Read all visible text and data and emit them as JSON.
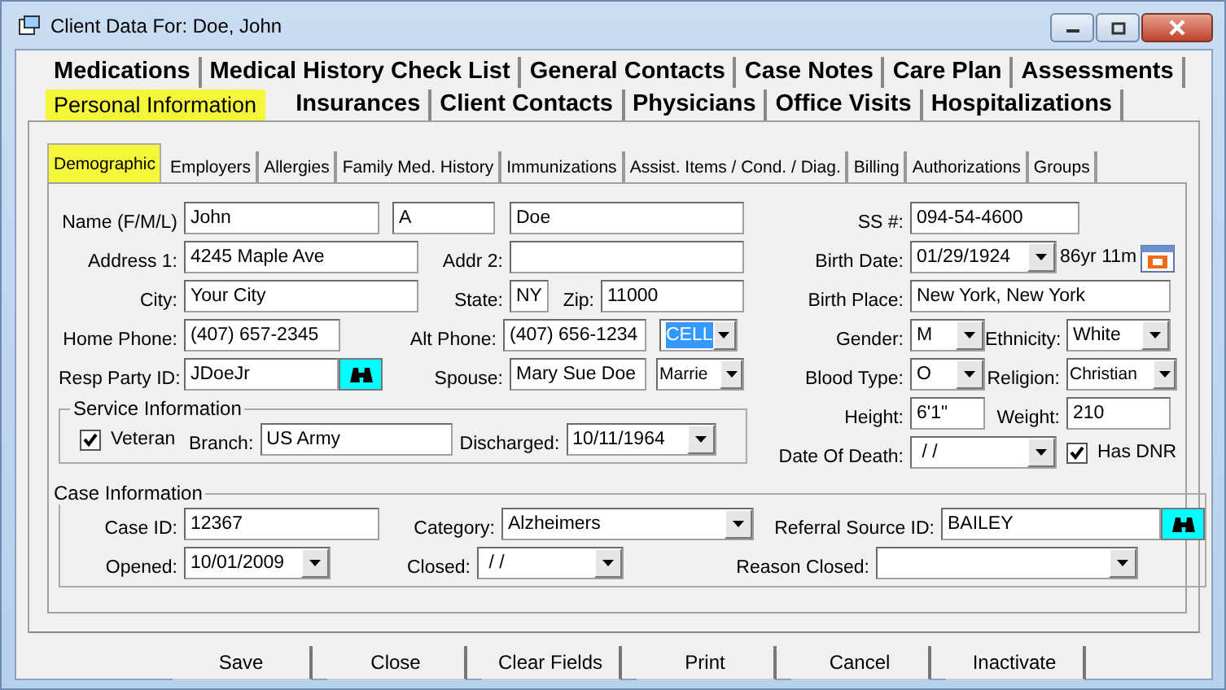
{
  "window": {
    "title": "Client Data For: Doe, John"
  },
  "main_tab_rows": [
    {
      "tabs": [
        {
          "label": "Medications",
          "selected": false
        },
        {
          "label": "Medical History Check List",
          "selected": false
        },
        {
          "label": "General Contacts",
          "selected": false
        },
        {
          "label": "Case Notes",
          "selected": false
        },
        {
          "label": "Care Plan",
          "selected": false
        },
        {
          "label": "Assessments",
          "selected": false
        }
      ]
    },
    {
      "tabs": [
        {
          "label": "Personal Information",
          "selected": true
        },
        {
          "label": "Insurances",
          "selected": false
        },
        {
          "label": "Client Contacts",
          "selected": false
        },
        {
          "label": "Physicians",
          "selected": false
        },
        {
          "label": "Office Visits",
          "selected": false
        },
        {
          "label": "Hospitalizations",
          "selected": false
        }
      ]
    }
  ],
  "sub_tabs": [
    {
      "label": "Demographic",
      "selected": true
    },
    {
      "label": "Employers",
      "selected": false
    },
    {
      "label": "Allergies",
      "selected": false
    },
    {
      "label": "Family Med. History",
      "selected": false
    },
    {
      "label": "Immunizations",
      "selected": false
    },
    {
      "label": "Assist. Items / Cond. / Diag.",
      "selected": false
    },
    {
      "label": "Billing",
      "selected": false
    },
    {
      "label": "Authorizations",
      "selected": false
    },
    {
      "label": "Groups",
      "selected": false
    }
  ],
  "demographic": {
    "name": {
      "label": "Name (F/M/L)",
      "first": "John",
      "middle": "A",
      "last": "Doe"
    },
    "address1": {
      "label": "Address 1:",
      "value": "4245 Maple Ave"
    },
    "address2": {
      "label": "Addr 2:"
    },
    "city": {
      "label": "City:",
      "value": "Your City"
    },
    "state": {
      "label": "State:",
      "value": "NY"
    },
    "zip": {
      "label": "Zip:",
      "value": "11000"
    },
    "home_phone": {
      "label": "Home Phone:",
      "value": "(407) 657-2345"
    },
    "alt_phone": {
      "label": "Alt Phone:",
      "value": "(407) 656-1234",
      "type": "CELL",
      "type_highlighted": true
    },
    "resp_party_id": {
      "label": "Resp Party ID:",
      "value": "JDoeJr"
    },
    "spouse": {
      "label": "Spouse:",
      "value": "Mary Sue Doe",
      "marital_status": "Marrie"
    },
    "ss": {
      "label": "SS #:",
      "value": "094-54-4600"
    },
    "birth_date": {
      "label": "Birth Date:",
      "value": "01/29/1924",
      "age": "86yr 11m"
    },
    "birth_place": {
      "label": "Birth Place:",
      "value": "New York, New York"
    },
    "gender": {
      "label": "Gender:",
      "value": "M"
    },
    "ethnicity": {
      "label": "Ethnicity:",
      "value": "White"
    },
    "blood_type": {
      "label": "Blood Type:",
      "value": "O"
    },
    "religion": {
      "label": "Religion:",
      "value": "Christian"
    },
    "height": {
      "label": "Height:",
      "value": "6'1\""
    },
    "weight": {
      "label": "Weight:",
      "value": "210"
    },
    "date_of_death": {
      "label": "Date Of Death:",
      "value": " / /"
    },
    "has_dnr": {
      "label": "Has DNR",
      "checked": true
    },
    "service": {
      "title": "Service Information",
      "veteran": {
        "label": "Veteran",
        "checked": true
      },
      "branch": {
        "label": "Branch:",
        "value": "US Army"
      },
      "discharged": {
        "label": "Discharged:",
        "value": "10/11/1964"
      }
    },
    "case": {
      "title": "Case Information",
      "case_id": {
        "label": "Case ID:",
        "value": "12367"
      },
      "category": {
        "label": "Category:",
        "value": "Alzheimers"
      },
      "referral_source_id": {
        "label": "Referral Source ID:",
        "value": "BAILEY"
      },
      "opened": {
        "label": "Opened:",
        "value": "10/01/2009"
      },
      "closed": {
        "label": "Closed:",
        "value": " / /"
      },
      "reason_closed": {
        "label": "Reason Closed:"
      }
    }
  },
  "buttons": [
    {
      "label": "Save"
    },
    {
      "label": "Close"
    },
    {
      "label": "Clear Fields"
    },
    {
      "label": "Print"
    },
    {
      "label": "Cancel"
    },
    {
      "label": "Inactivate"
    }
  ]
}
